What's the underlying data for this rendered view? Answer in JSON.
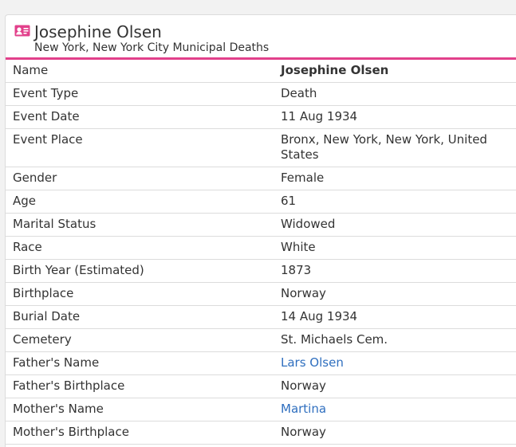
{
  "header": {
    "title": "Josephine Olsen",
    "subtitle": "New York, New York City Municipal Deaths",
    "icon": "person-record-icon",
    "accent_color": "#e2408b"
  },
  "link_color": "#2f6fbf",
  "fields": [
    {
      "label": "Name",
      "value": "Josephine Olsen"
    },
    {
      "label": "Event Type",
      "value": "Death"
    },
    {
      "label": "Event Date",
      "value": "11 Aug 1934"
    },
    {
      "label": "Event Place",
      "value": "Bronx, New York, New York, United States"
    },
    {
      "label": "Gender",
      "value": "Female"
    },
    {
      "label": "Age",
      "value": "61"
    },
    {
      "label": "Marital Status",
      "value": "Widowed"
    },
    {
      "label": "Race",
      "value": "White"
    },
    {
      "label": "Birth Year (Estimated)",
      "value": "1873"
    },
    {
      "label": "Birthplace",
      "value": "Norway"
    },
    {
      "label": "Burial Date",
      "value": "14 Aug 1934"
    },
    {
      "label": "Cemetery",
      "value": "St. Michaels Cem."
    },
    {
      "label": "Father's Name",
      "value": "Lars Olsen",
      "link": true
    },
    {
      "label": "Father's Birthplace",
      "value": "Norway"
    },
    {
      "label": "Mother's Name",
      "value": "Martina",
      "link": true
    },
    {
      "label": "Mother's Birthplace",
      "value": "Norway"
    }
  ]
}
